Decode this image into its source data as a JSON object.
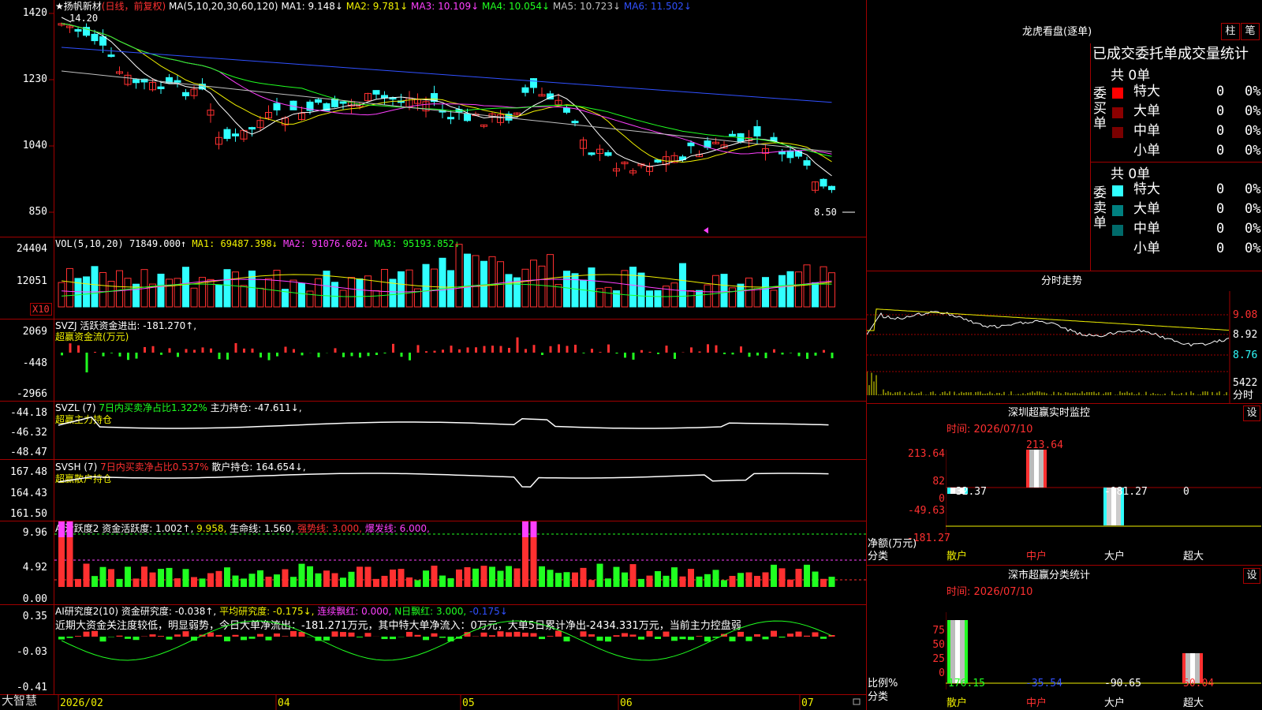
{
  "colors": {
    "up": "#ff3030",
    "down": "#30ffff",
    "grid": "#a00000",
    "ma1": "#ffffff",
    "ma2": "#f0f000",
    "ma3": "#ff40ff",
    "ma4": "#20ff20",
    "ma5": "#c0c0c0",
    "ma6": "#3050ff"
  },
  "main": {
    "y_labels": [
      "1420",
      "1230",
      "1040",
      "850"
    ],
    "stock": "扬帆新材",
    "period": "(日线，前复权)",
    "ma_prefix": "MA(5,10,20,30,60,120)",
    "ma1": "MA1: 9.148↓",
    "ma2": "MA2: 9.781↓",
    "ma3": "MA3: 10.109↓",
    "ma4": "MA4: 10.054↓",
    "ma5": "MA5: 10.723↓",
    "ma6": "MA6: 11.502↓",
    "high_label": "14.20",
    "low_label": "8.50"
  },
  "vol": {
    "y_labels": [
      "24404",
      "12051"
    ],
    "unit": "X10",
    "header": "VOL(5,10,20)",
    "value": "71849.000↑",
    "ma1": "MA1: 69487.398↓",
    "ma2": "MA2: 91076.602↓",
    "ma3": "MA3: 95193.852↓"
  },
  "svzj": {
    "y_labels": [
      "2069",
      "-448",
      "-2966"
    ],
    "header": "SVZJ  活跃资金进出: -181.270↑,",
    "sub": "超赢资金流(万元)"
  },
  "svzl": {
    "y_labels": [
      "-44.18",
      "-46.32",
      "-48.47"
    ],
    "header": "SVZL (7)",
    "ratio": "7日内买卖净占比1.322%",
    "hold": "主力持仓: -47.611↓,",
    "sub": "超赢主力持仓"
  },
  "svsh": {
    "y_labels": [
      "167.48",
      "164.43",
      "161.50"
    ],
    "header": "SVSH (7)",
    "ratio": "7日内买卖净占比0.537%",
    "hold": "散户持仓: 164.654↓,",
    "sub": "超赢散户持仓"
  },
  "ai1": {
    "y_labels": [
      "9.96",
      "4.92",
      "0.00"
    ],
    "header": "AI活跃度2 资金活跃度: 1.002↑,",
    "v2": "9.958,",
    "life": "生命线: 1.560,",
    "strong": "强势线: 3.000,",
    "burst": "爆发线: 6.000,"
  },
  "ai2": {
    "y_labels": [
      "0.35",
      "-0.03",
      "-0.41"
    ],
    "header": "AI研究度2(10) 资金研究度: -0.038↑,",
    "avg": "平均研究度: -0.175↓,",
    "cont": "连续飘红: 0.000,",
    "nday": "N日飘红: 3.000,",
    "last": "-0.175↓",
    "comment": "近期大资金关注度较低，明显弱势，今日大单净流出：-181.271万元，其中特大单净流入：0万元，大单5日累计净出-2434.331万元，当前主力控盘弱"
  },
  "xaxis": {
    "brand": "大智慧",
    "labels": [
      "2026/02",
      "04",
      "05",
      "06",
      "07"
    ]
  },
  "dragon": {
    "title": "龙虎看盘(逐单)",
    "btn1": "柱",
    "btn2": "笔",
    "subtitle": "已成交委托单成交量统计",
    "buy_label": "委买单",
    "sell_label": "委卖单",
    "buy_total": "共 0单",
    "sell_total": "共 0单",
    "buy_rows": [
      {
        "name": "特大",
        "n": "0",
        "p": "0%"
      },
      {
        "name": "大单",
        "n": "0",
        "p": "0%"
      },
      {
        "name": "中单",
        "n": "0",
        "p": "0%"
      },
      {
        "name": "小单",
        "n": "0",
        "p": "0%"
      }
    ],
    "sell_rows": [
      {
        "name": "特大",
        "n": "0",
        "p": "0%"
      },
      {
        "name": "大单",
        "n": "0",
        "p": "0%"
      },
      {
        "name": "中单",
        "n": "0",
        "p": "0%"
      },
      {
        "name": "小单",
        "n": "0",
        "p": "0%"
      }
    ]
  },
  "intraday": {
    "title": "分时走势",
    "prices": [
      "9.08",
      "8.92",
      "8.76"
    ],
    "vol": "5422",
    "vol_unit": "分时"
  },
  "sz_monitor": {
    "title": "深圳超赢实时监控",
    "btn": "设",
    "time": "时间: 2026/07/10",
    "y_labels": [
      "213.64",
      "82",
      "0",
      "-49.63",
      "-181.27"
    ],
    "values": [
      "-32.37",
      "213.64",
      "-181.27",
      "0"
    ],
    "cats": [
      "散户",
      "中户",
      "大户",
      "超大"
    ],
    "yname": "净额(万元)",
    "xname": "分类"
  },
  "sz_class": {
    "title": "深市超赢分类统计",
    "btn": "设",
    "time": "时间: 2026/07/10",
    "y_labels": [
      "75",
      "50",
      "25",
      "0"
    ],
    "values": [
      "176.15",
      "-35.54",
      "-90.65",
      "50.04"
    ],
    "cats": [
      "散户",
      "中户",
      "大户",
      "超大"
    ],
    "yname": "比例%",
    "xname": "分类"
  }
}
